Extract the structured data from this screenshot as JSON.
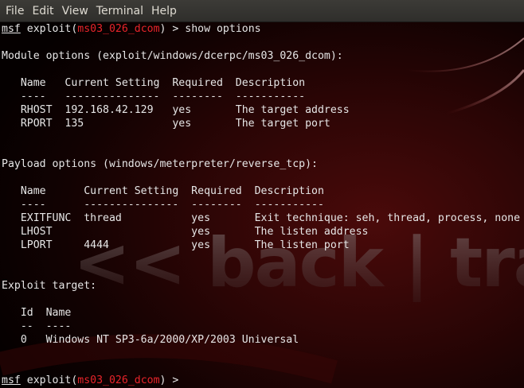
{
  "menu": [
    "File",
    "Edit",
    "View",
    "Terminal",
    "Help"
  ],
  "prompt": {
    "msf": "msf",
    "exploit_prefix": " exploit(",
    "module": "ms03_026_dcom",
    "exploit_suffix": ")",
    "arrow": " > ",
    "command": "show options"
  },
  "module_options": {
    "heading": "Module options (exploit/windows/dcerpc/ms03_026_dcom):",
    "header": "   Name   Current Setting  Required  Description",
    "divider": "   ----   ---------------  --------  -----------",
    "rows": [
      "   RHOST  192.168.42.129   yes       The target address",
      "   RPORT  135              yes       The target port"
    ]
  },
  "payload_options": {
    "heading": "Payload options (windows/meterpreter/reverse_tcp):",
    "header": "   Name      Current Setting  Required  Description",
    "divider": "   ----      ---------------  --------  -----------",
    "rows": [
      "   EXITFUNC  thread           yes       Exit technique: seh, thread, process, none",
      "   LHOST                      yes       The listen address",
      "   LPORT     4444             yes       The listen port"
    ]
  },
  "exploit_target": {
    "heading": "Exploit target:",
    "header": "   Id  Name",
    "divider": "   --  ----",
    "rows": [
      "   0   Windows NT SP3-6a/2000/XP/2003 Universal"
    ]
  },
  "final_prompt": {
    "msf": "msf",
    "exploit_prefix": " exploit(",
    "module": "ms03_026_dcom",
    "exploit_suffix": ")",
    "arrow": " > "
  },
  "background": {
    "watermark": "<< back | track",
    "colors": {
      "accent": "#e8242a",
      "text": "#e6e6e6",
      "bg": "#2a0505"
    }
  }
}
